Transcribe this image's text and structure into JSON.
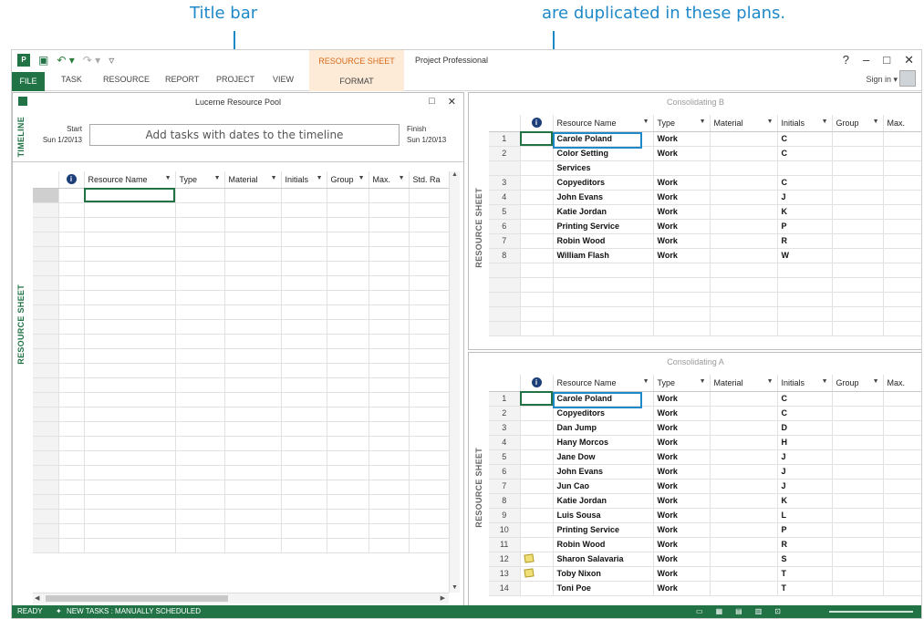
{
  "callouts": {
    "title_bar": "Title bar",
    "duplicated": "are duplicated in these plans."
  },
  "app": {
    "title": "Project Professional",
    "context_title": "RESOURCE SHEET TOOLS",
    "sign_in": "Sign in",
    "help": "?",
    "minimize": "–",
    "restore": "□",
    "close": "✕"
  },
  "tabs": {
    "file": "FILE",
    "task": "TASK",
    "resource": "RESOURCE",
    "report": "REPORT",
    "project": "PROJECT",
    "view": "VIEW",
    "format": "FORMAT"
  },
  "left_pane": {
    "title": "Lucerne Resource Pool",
    "timeline_label": "TIMELINE",
    "start_label": "Start",
    "start_date": "Sun 1/20/13",
    "finish_label": "Finish",
    "finish_date": "Sun 1/20/13",
    "timeline_hint": "Add tasks with dates to the timeline",
    "sheet_label": "RESOURCE SHEET",
    "columns": [
      "Resource Name",
      "Type",
      "Material",
      "Initials",
      "Group",
      "Max.",
      "Std. Ra"
    ]
  },
  "pane_b": {
    "title": "Consolidating B",
    "sheet_label": "RESOURCE SHEET",
    "columns": [
      "Resource Name",
      "Type",
      "Material",
      "Initials",
      "Group",
      "Max."
    ],
    "rows": [
      {
        "id": "1",
        "name": "Carole Poland",
        "type": "Work",
        "initials": "C"
      },
      {
        "id": "2",
        "name": "Color Setting",
        "type": "Work",
        "initials": "C"
      },
      {
        "id": "",
        "name": "Services",
        "type": "",
        "initials": ""
      },
      {
        "id": "3",
        "name": "Copyeditors",
        "type": "Work",
        "initials": "C"
      },
      {
        "id": "4",
        "name": "John Evans",
        "type": "Work",
        "initials": "J"
      },
      {
        "id": "5",
        "name": "Katie Jordan",
        "type": "Work",
        "initials": "K"
      },
      {
        "id": "6",
        "name": "Printing Service",
        "type": "Work",
        "initials": "P"
      },
      {
        "id": "7",
        "name": "Robin Wood",
        "type": "Work",
        "initials": "R"
      },
      {
        "id": "8",
        "name": "William Flash",
        "type": "Work",
        "initials": "W"
      }
    ]
  },
  "pane_a": {
    "title": "Consolidating A",
    "sheet_label": "RESOURCE SHEET",
    "columns": [
      "Resource Name",
      "Type",
      "Material",
      "Initials",
      "Group",
      "Max."
    ],
    "rows": [
      {
        "id": "1",
        "name": "Carole Poland",
        "type": "Work",
        "initials": "C",
        "note": false
      },
      {
        "id": "2",
        "name": "Copyeditors",
        "type": "Work",
        "initials": "C",
        "note": false
      },
      {
        "id": "3",
        "name": "Dan Jump",
        "type": "Work",
        "initials": "D",
        "note": false
      },
      {
        "id": "4",
        "name": "Hany Morcos",
        "type": "Work",
        "initials": "H",
        "note": false
      },
      {
        "id": "5",
        "name": "Jane Dow",
        "type": "Work",
        "initials": "J",
        "note": false
      },
      {
        "id": "6",
        "name": "John Evans",
        "type": "Work",
        "initials": "J",
        "note": false
      },
      {
        "id": "7",
        "name": "Jun Cao",
        "type": "Work",
        "initials": "J",
        "note": false
      },
      {
        "id": "8",
        "name": "Katie Jordan",
        "type": "Work",
        "initials": "K",
        "note": false
      },
      {
        "id": "9",
        "name": "Luis Sousa",
        "type": "Work",
        "initials": "L",
        "note": false
      },
      {
        "id": "10",
        "name": "Printing Service",
        "type": "Work",
        "initials": "P",
        "note": false
      },
      {
        "id": "11",
        "name": "Robin Wood",
        "type": "Work",
        "initials": "R",
        "note": false
      },
      {
        "id": "12",
        "name": "Sharon Salavaria",
        "type": "Work",
        "initials": "S",
        "note": true
      },
      {
        "id": "13",
        "name": "Toby Nixon",
        "type": "Work",
        "initials": "T",
        "note": true
      },
      {
        "id": "14",
        "name": "Toni Poe",
        "type": "Work",
        "initials": "T",
        "note": false
      }
    ]
  },
  "status": {
    "ready": "READY",
    "task_mode": "NEW TASKS : MANUALLY SCHEDULED"
  },
  "colors": {
    "accent": "#217346",
    "callout": "#1e88c9",
    "context_tab": "#fdebd7"
  }
}
